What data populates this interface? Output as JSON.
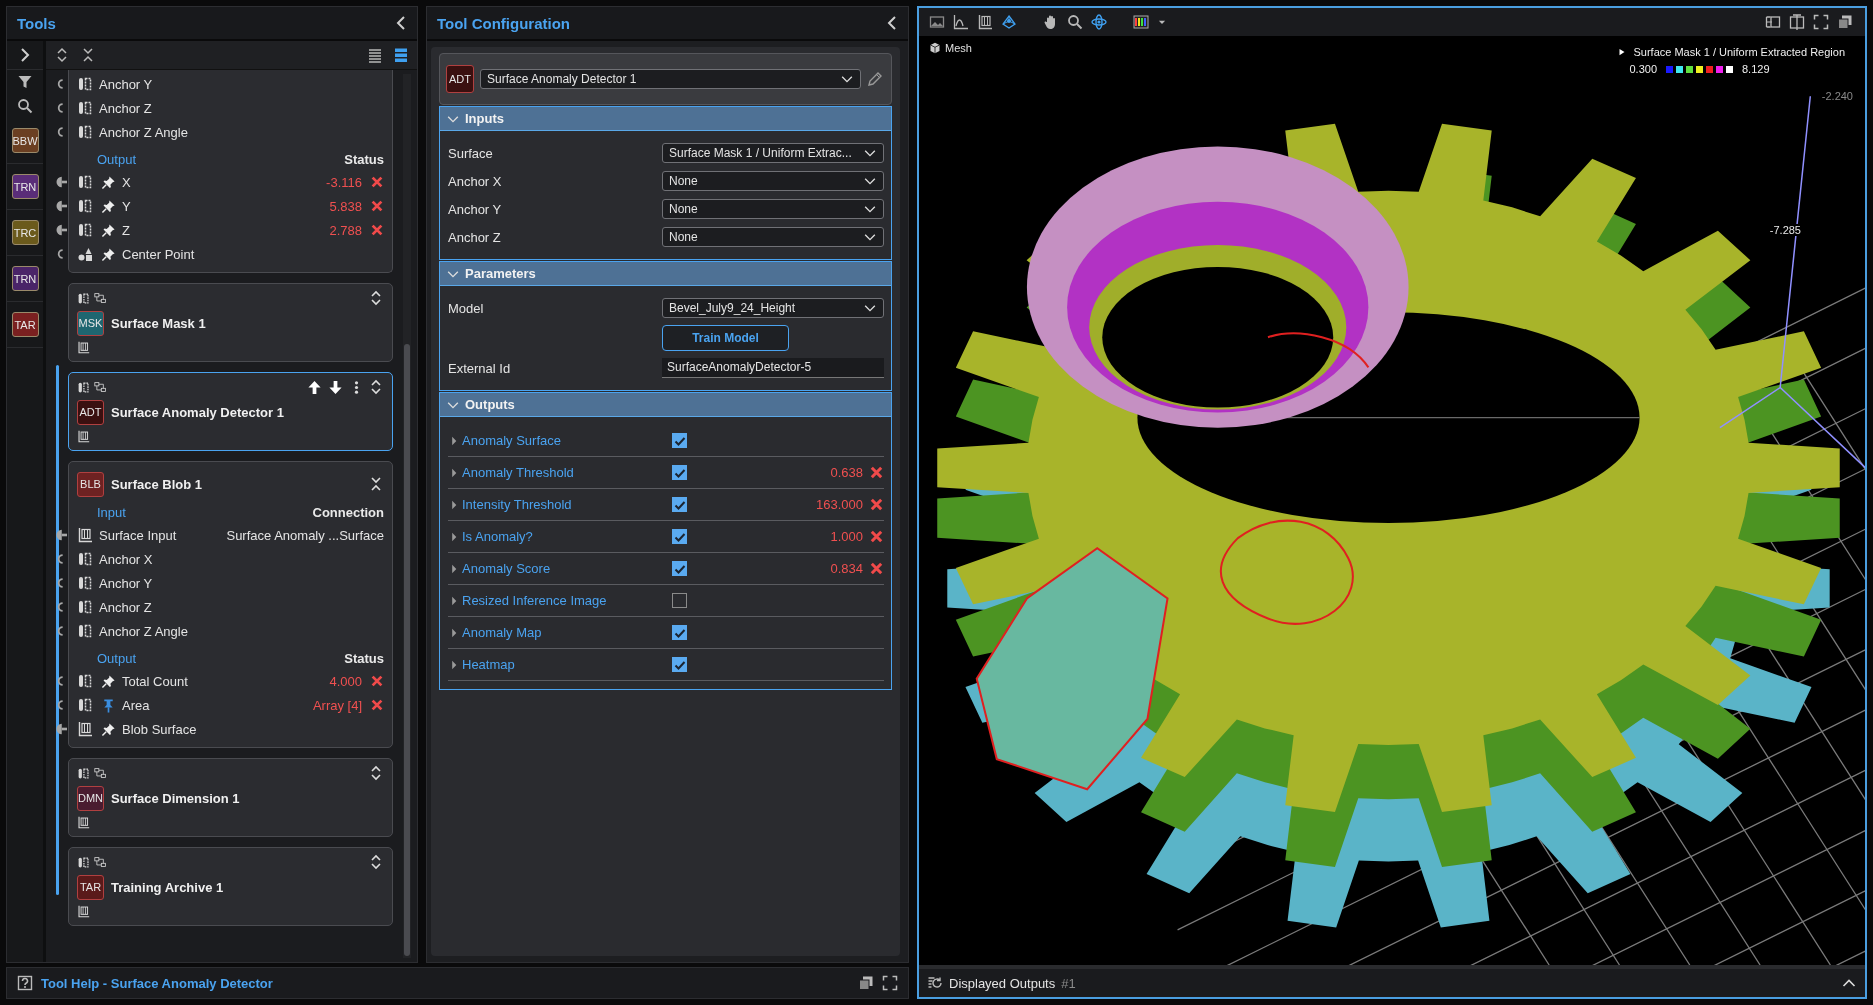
{
  "tools_panel": {
    "title": "Tools",
    "rail_badges": [
      {
        "label": "BBW",
        "color": "#6b3f22"
      },
      {
        "label": "TRN",
        "color": "#5a2d78"
      },
      {
        "label": "TRC",
        "color": "#6b5a1c"
      },
      {
        "label": "TRN",
        "color": "#4a2468"
      },
      {
        "label": "TAR",
        "color": "#7a2020"
      }
    ],
    "tree_toolbar": {
      "view_modes": [
        {
          "selected": false
        },
        {
          "selected": true
        }
      ]
    },
    "cards": [
      {
        "inputs": [
          {
            "label": "Anchor Y",
            "kind": "number",
            "connected": false
          },
          {
            "label": "Anchor Z",
            "kind": "number",
            "connected": false
          },
          {
            "label": "Anchor Z Angle",
            "kind": "number",
            "connected": false
          }
        ],
        "output_header": "Output",
        "status_header": "Status",
        "outputs": [
          {
            "label": "X",
            "kind": "number",
            "connected": true,
            "pinned": false,
            "value": "-3.116",
            "failed": true
          },
          {
            "label": "Y",
            "kind": "number",
            "connected": true,
            "pinned": false,
            "value": "5.838",
            "failed": true
          },
          {
            "label": "Z",
            "kind": "number",
            "connected": true,
            "pinned": false,
            "value": "2.788",
            "failed": true
          },
          {
            "label": "Center Point",
            "kind": "point",
            "connected": false,
            "pinned": false
          }
        ]
      },
      {
        "name": "Surface Mask 1",
        "badge": "MSK",
        "color": "#1f6670",
        "expanded": false,
        "selected": false
      },
      {
        "name": "Surface Anomaly Detector 1",
        "badge": "ADT",
        "color": "#3a1010",
        "expanded": false,
        "selected": true
      },
      {
        "name": "Surface Blob 1",
        "badge": "BLB",
        "color": "#6e2222",
        "expanded": true,
        "selected": false,
        "input_header": "Input",
        "connection_header": "Connection",
        "inputs": [
          {
            "label": "Surface Input",
            "kind": "surface",
            "connected": true,
            "connection": "Surface Anomaly ...Surface"
          },
          {
            "label": "Anchor X",
            "kind": "number",
            "connected": false
          },
          {
            "label": "Anchor Y",
            "kind": "number",
            "connected": false
          },
          {
            "label": "Anchor Z",
            "kind": "number",
            "connected": false
          },
          {
            "label": "Anchor Z Angle",
            "kind": "number",
            "connected": false
          }
        ],
        "output_header": "Output",
        "status_header": "Status",
        "outputs": [
          {
            "label": "Total Count",
            "kind": "number",
            "connected": false,
            "pinned": false,
            "value": "4.000",
            "failed": true
          },
          {
            "label": "Area",
            "kind": "number",
            "connected": false,
            "pinned": true,
            "value": "Array [4]",
            "failed": true
          },
          {
            "label": "Blob Surface",
            "kind": "surface",
            "connected": true,
            "pinned": false
          }
        ]
      },
      {
        "name": "Surface Dimension 1",
        "badge": "DMN",
        "color": "#4a1c30",
        "expanded": false,
        "selected": false
      },
      {
        "name": "Training Archive 1",
        "badge": "TAR",
        "color": "#5a1a1a",
        "expanded": false,
        "selected": false
      }
    ]
  },
  "tool_config": {
    "title": "Tool Configuration",
    "tool": {
      "badge": "ADT",
      "color": "#3a1010",
      "name": "Surface Anomaly Detector 1"
    },
    "sections": [
      {
        "title": "Inputs",
        "expanded": true,
        "fields": [
          {
            "kind": "dropdown",
            "label": "Surface",
            "value": "Surface Mask 1 / Uniform Extrac..."
          },
          {
            "kind": "dropdown",
            "label": "Anchor X",
            "value": "None"
          },
          {
            "kind": "dropdown",
            "label": "Anchor Y",
            "value": "None"
          },
          {
            "kind": "dropdown",
            "label": "Anchor Z",
            "value": "None"
          }
        ]
      },
      {
        "title": "Parameters",
        "expanded": true,
        "fields": [
          {
            "kind": "dropdown",
            "label": "Model",
            "value": "Bevel_July9_24_Height"
          },
          {
            "kind": "button",
            "text": "Train Model"
          },
          {
            "kind": "text",
            "label": "External Id",
            "value": "SurfaceAnomalyDetector-5"
          }
        ]
      },
      {
        "title": "Outputs",
        "expanded": true,
        "outputs": [
          {
            "label": "Anomaly Surface",
            "checked": true
          },
          {
            "label": "Anomaly Threshold",
            "checked": true,
            "value": "0.638",
            "failed": true
          },
          {
            "label": "Intensity Threshold",
            "checked": true,
            "value": "163.000",
            "failed": true
          },
          {
            "label": "Is Anomaly?",
            "checked": true,
            "value": "1.000",
            "failed": true
          },
          {
            "label": "Anomaly Score",
            "checked": true,
            "value": "0.834",
            "failed": true
          },
          {
            "label": "Resized Inference Image",
            "checked": false
          },
          {
            "label": "Anomaly Map",
            "checked": true
          },
          {
            "label": "Heatmap",
            "checked": true
          }
        ]
      }
    ]
  },
  "status_bar": {
    "text": "Tool Help - Surface Anomaly Detector"
  },
  "viewer": {
    "display_modes": [
      {
        "selected": false
      },
      {
        "selected": false
      },
      {
        "selected": false
      },
      {
        "selected": true
      }
    ],
    "navigation_modes": [
      {
        "selected": false
      },
      {
        "selected": false
      },
      {
        "selected": true
      }
    ],
    "view_label": "Mesh",
    "legend": {
      "title": "Surface Mask 1 / Uniform Extracted Region",
      "min": "0.300",
      "max": "8.129",
      "swatches": [
        {
          "color": "#1a1aff"
        },
        {
          "color": "#40e8f0"
        },
        {
          "color": "#60e040"
        },
        {
          "color": "#f0f020"
        },
        {
          "color": "#f02020"
        },
        {
          "color": "#f020f0"
        },
        {
          "color": "#ffffff"
        }
      ]
    },
    "axis_labels": [
      "-2.240",
      "-7.285"
    ],
    "footer": {
      "label": "Displayed Outputs",
      "count": "#1"
    }
  }
}
